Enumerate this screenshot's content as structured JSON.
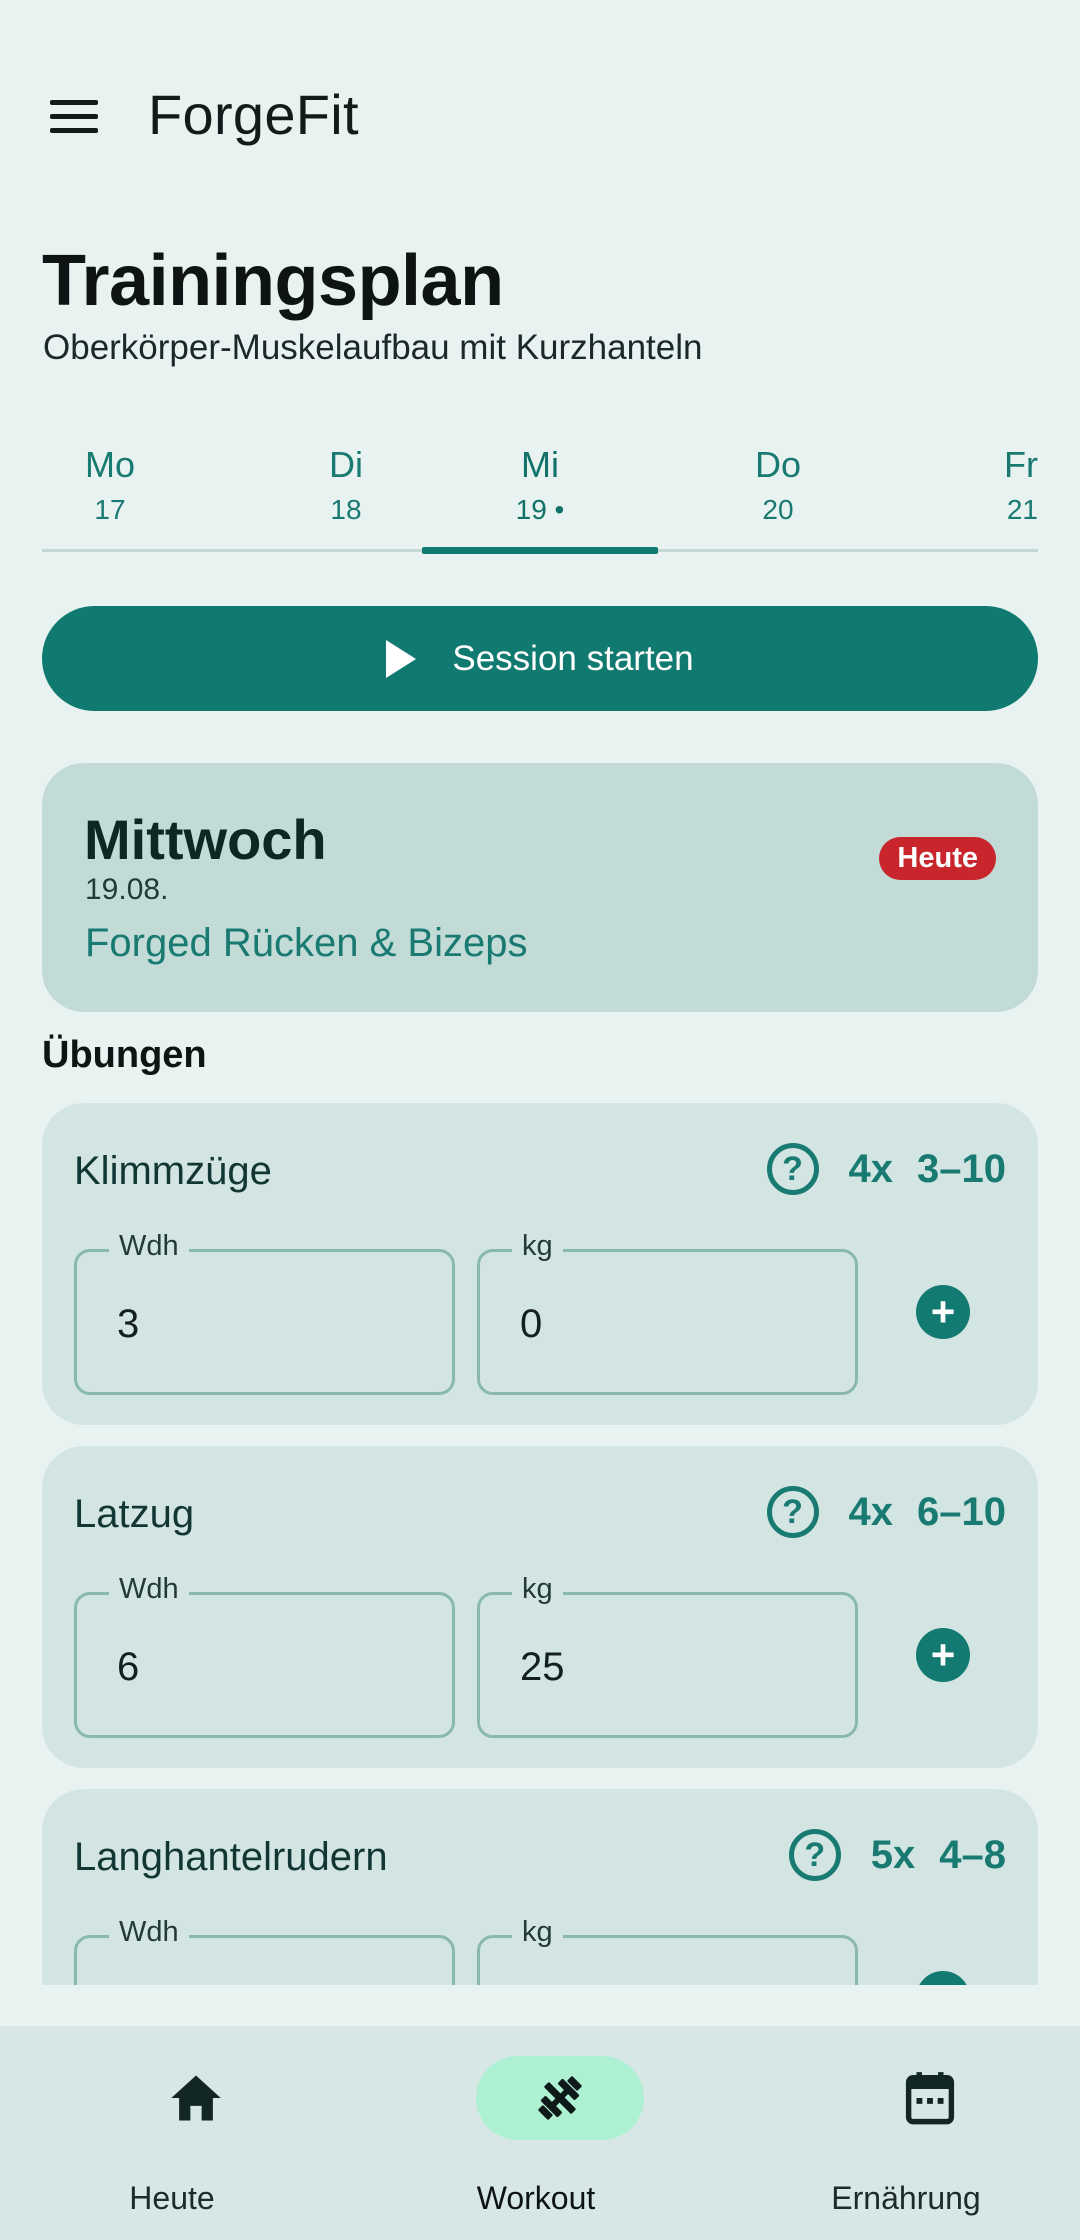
{
  "app": {
    "title": "ForgeFit"
  },
  "header": {
    "title": "Trainingsplan",
    "subtitle": "Oberkörper-Muskelaufbau mit Kurzhanteln"
  },
  "days": [
    {
      "name": "Mo",
      "date": "17",
      "selected": false
    },
    {
      "name": "Di",
      "date": "18",
      "selected": false
    },
    {
      "name": "Mi",
      "date": "19 •",
      "selected": true
    },
    {
      "name": "Do",
      "date": "20",
      "selected": false
    },
    {
      "name": "Fr",
      "date": "21",
      "selected": false
    }
  ],
  "start_button": {
    "label": "Session starten"
  },
  "day_card": {
    "name": "Mittwoch",
    "date": "19.08.",
    "program": "Forged Rücken & Bizeps",
    "badge": "Heute"
  },
  "exercises_section": {
    "title": "Übungen"
  },
  "exercises": [
    {
      "name": "Klimmzüge",
      "sets": "4x",
      "reps": "3–10",
      "reps_label": "Wdh",
      "reps_value": "3",
      "weight_label": "kg",
      "weight_value": "0"
    },
    {
      "name": "Latzug",
      "sets": "4x",
      "reps": "6–10",
      "reps_label": "Wdh",
      "reps_value": "6",
      "weight_label": "kg",
      "weight_value": "25"
    },
    {
      "name": "Langhantelrudern",
      "sets": "5x",
      "reps": "4–8",
      "reps_label": "Wdh",
      "reps_value": "",
      "weight_label": "kg",
      "weight_value": ""
    }
  ],
  "bottom_nav": [
    {
      "label": "Heute",
      "icon": "home-icon",
      "active": false
    },
    {
      "label": "Workout",
      "icon": "dumbbell-icon",
      "active": true
    },
    {
      "label": "Ernährung",
      "icon": "calendar-icon",
      "active": false
    }
  ],
  "colors": {
    "background": "#e8f2f1",
    "accent": "#107a70",
    "badge": "#c8262c",
    "active_nav_pill": "#aef0d2"
  }
}
